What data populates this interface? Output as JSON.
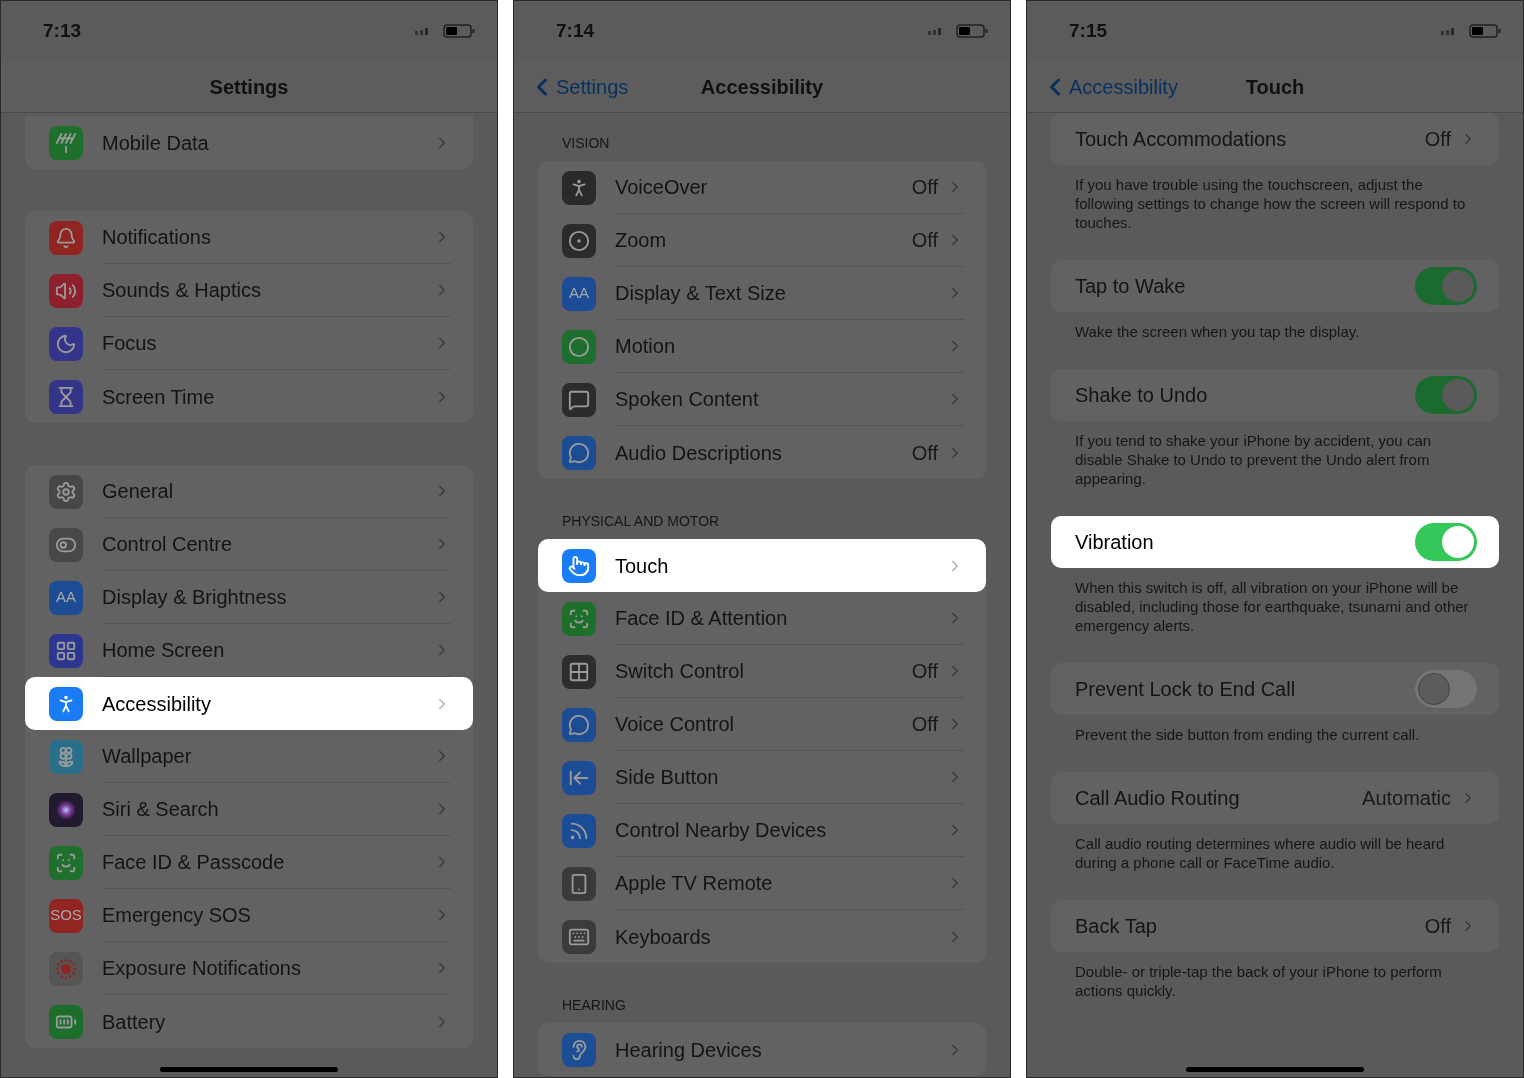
{
  "screens": [
    {
      "time": "7:13",
      "title": "Settings",
      "sections": [
        {
          "rows": [
            {
              "label": "Mobile Data",
              "color": "#1e6e2c",
              "selected": false
            }
          ]
        },
        {
          "rows": [
            {
              "label": "Notifications",
              "color": "#8f2420",
              "selected": false
            },
            {
              "label": "Sounds & Haptics",
              "color": "#8e1f2c",
              "selected": false
            },
            {
              "label": "Focus",
              "color": "#34358a",
              "selected": false
            },
            {
              "label": "Screen Time",
              "color": "#343589",
              "selected": false
            }
          ]
        },
        {
          "rows": [
            {
              "label": "General",
              "color": "#474747",
              "selected": false
            },
            {
              "label": "Control Centre",
              "color": "#484848",
              "selected": false
            },
            {
              "label": "Display & Brightness",
              "color": "#1b4c94",
              "icon_text": "AA",
              "selected": false
            },
            {
              "label": "Home Screen",
              "color": "#2c3590",
              "selected": false
            },
            {
              "label": "Accessibility",
              "color": "#1a7cf5",
              "selected": true
            },
            {
              "label": "Wallpaper",
              "color": "#2a6f8a",
              "selected": false
            },
            {
              "label": "Siri & Search",
              "color": "#241a30",
              "selected": false
            },
            {
              "label": "Face ID & Passcode",
              "color": "#1f6f2d",
              "selected": false
            },
            {
              "label": "Emergency SOS",
              "color": "#902521",
              "icon_text": "SOS",
              "selected": false
            },
            {
              "label": "Exposure Notifications",
              "color": "#555555",
              "selected": false
            },
            {
              "label": "Battery",
              "color": "#1d6d2b",
              "selected": false
            }
          ]
        }
      ]
    },
    {
      "time": "7:14",
      "back": "Settings",
      "title": "Accessibility",
      "sections": [
        {
          "header": "VISION",
          "rows": [
            {
              "label": "VoiceOver",
              "value": "Off",
              "color": "#2a2a2a",
              "selected": false
            },
            {
              "label": "Zoom",
              "value": "Off",
              "color": "#2b2b2b",
              "selected": false
            },
            {
              "label": "Display & Text Size",
              "color": "#1b4c95",
              "icon_text": "AA",
              "selected": false
            },
            {
              "label": "Motion",
              "color": "#1e6e2d",
              "selected": false
            },
            {
              "label": "Spoken Content",
              "color": "#2c2c2c",
              "selected": false
            },
            {
              "label": "Audio Descriptions",
              "value": "Off",
              "color": "#1b4d94",
              "selected": false
            }
          ]
        },
        {
          "header": "PHYSICAL AND MOTOR",
          "rows": [
            {
              "label": "Touch",
              "color": "#1a7cf6",
              "selected": true
            },
            {
              "label": "Face ID & Attention",
              "color": "#1e6f2c",
              "selected": false
            },
            {
              "label": "Switch Control",
              "value": "Off",
              "color": "#2d2d2d",
              "selected": false
            },
            {
              "label": "Voice Control",
              "value": "Off",
              "color": "#1c4c94",
              "selected": false
            },
            {
              "label": "Side Button",
              "color": "#1c4d94",
              "selected": false
            },
            {
              "label": "Control Nearby Devices",
              "color": "#1b4c96",
              "selected": false
            },
            {
              "label": "Apple TV Remote",
              "color": "#3a3a3a",
              "selected": false
            },
            {
              "label": "Keyboards",
              "color": "#3b3b3b",
              "selected": false
            }
          ]
        },
        {
          "header": "HEARING",
          "rows": [
            {
              "label": "Hearing Devices",
              "color": "#1b4e94",
              "selected": false
            }
          ]
        }
      ]
    },
    {
      "time": "7:15",
      "back": "Accessibility",
      "title": "Touch",
      "sections": [
        {
          "rows": [
            {
              "kind": "link",
              "label": "Touch Accommodations",
              "value": "Off",
              "selected": false
            }
          ],
          "footer": "If you have trouble using the touchscreen, adjust the following settings to change how the screen will respond to touches."
        },
        {
          "rows": [
            {
              "kind": "toggle",
              "label": "Tap to Wake",
              "on": true,
              "selected": false
            }
          ],
          "footer": "Wake the screen when you tap the display."
        },
        {
          "rows": [
            {
              "kind": "toggle",
              "label": "Shake to Undo",
              "on": true,
              "selected": false
            }
          ],
          "footer": "If you tend to shake your iPhone by accident, you can disable Shake to Undo to prevent the Undo alert from appearing."
        },
        {
          "rows": [
            {
              "kind": "toggle",
              "label": "Vibration",
              "on": true,
              "selected": true
            }
          ],
          "footer": "When this switch is off, all vibration on your iPhone will be disabled, including those for earthquake, tsunami and other emergency alerts."
        },
        {
          "rows": [
            {
              "kind": "toggle",
              "label": "Prevent Lock to End Call",
              "on": false,
              "selected": false
            }
          ],
          "footer": "Prevent the side button from ending the current call."
        },
        {
          "rows": [
            {
              "kind": "link",
              "label": "Call Audio Routing",
              "value": "Automatic",
              "selected": false
            }
          ],
          "footer": "Call audio routing determines where audio will be heard during a phone call or FaceTime audio."
        },
        {
          "rows": [
            {
              "kind": "link",
              "label": "Back Tap",
              "value": "Off",
              "selected": false
            }
          ],
          "footer": "Double- or triple-tap the back of your iPhone to perform actions quickly."
        }
      ]
    }
  ]
}
